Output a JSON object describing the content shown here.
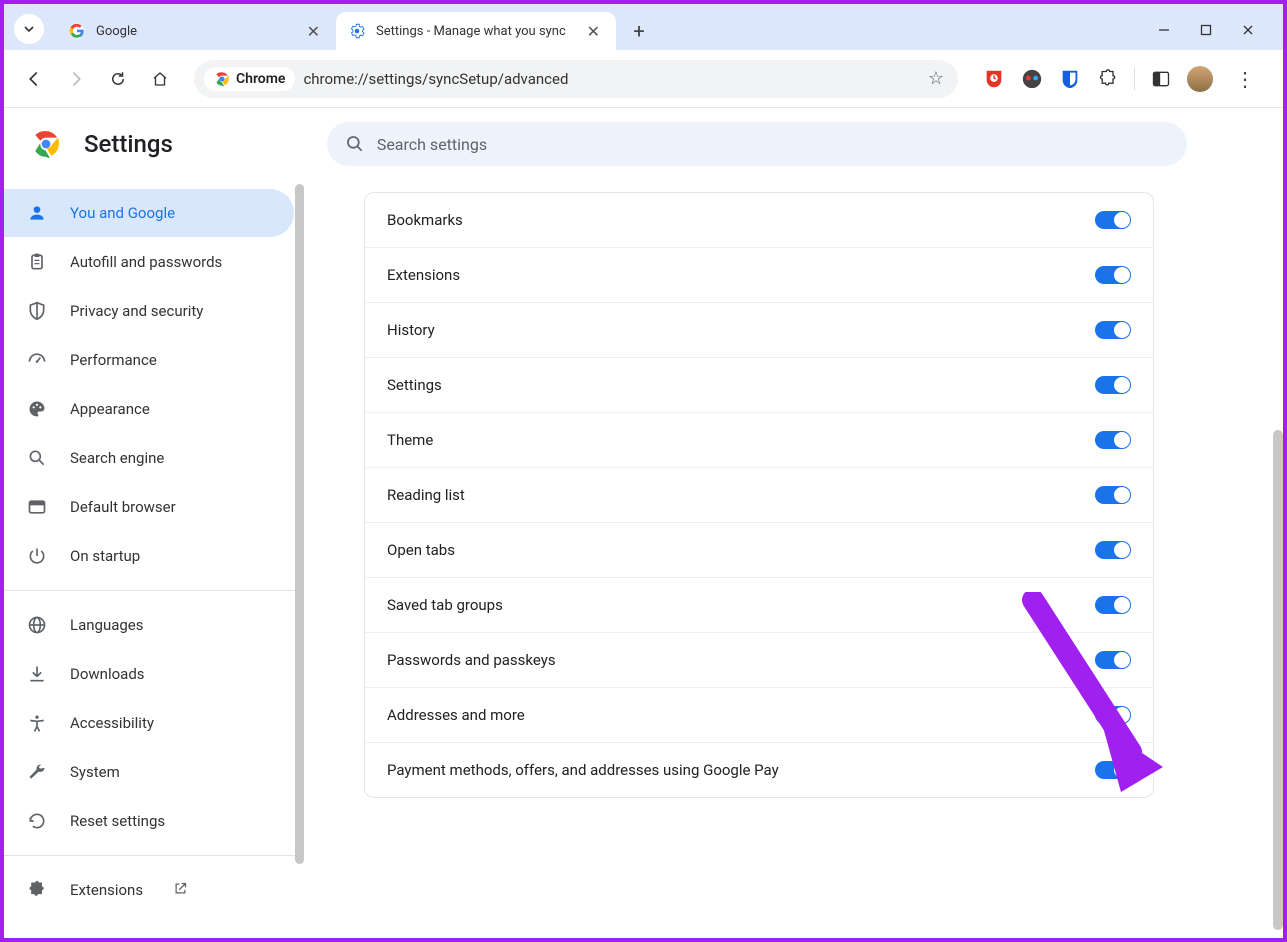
{
  "tabs": [
    {
      "title": "Google",
      "active": false
    },
    {
      "title": "Settings - Manage what you sync",
      "active": true
    }
  ],
  "url": "chrome://settings/syncSetup/advanced",
  "chrome_chip": "Chrome",
  "settings_title": "Settings",
  "search_placeholder": "Search settings",
  "sidebar": {
    "group1": [
      {
        "icon": "person",
        "label": "You and Google",
        "active": true,
        "name": "you-and-google"
      },
      {
        "icon": "clipboard",
        "label": "Autofill and passwords",
        "name": "autofill-passwords"
      },
      {
        "icon": "shield",
        "label": "Privacy and security",
        "name": "privacy-security"
      },
      {
        "icon": "speed",
        "label": "Performance",
        "name": "performance"
      },
      {
        "icon": "palette",
        "label": "Appearance",
        "name": "appearance"
      },
      {
        "icon": "search",
        "label": "Search engine",
        "name": "search-engine"
      },
      {
        "icon": "browser",
        "label": "Default browser",
        "name": "default-browser"
      },
      {
        "icon": "power",
        "label": "On startup",
        "name": "on-startup"
      }
    ],
    "group2": [
      {
        "icon": "globe",
        "label": "Languages",
        "name": "languages"
      },
      {
        "icon": "download",
        "label": "Downloads",
        "name": "downloads"
      },
      {
        "icon": "accessibility",
        "label": "Accessibility",
        "name": "accessibility"
      },
      {
        "icon": "wrench",
        "label": "System",
        "name": "system"
      },
      {
        "icon": "restore",
        "label": "Reset settings",
        "name": "reset-settings"
      }
    ],
    "group3": [
      {
        "icon": "puzzle",
        "label": "Extensions",
        "name": "extensions",
        "external": true
      }
    ]
  },
  "sync_items": [
    {
      "label": "Bookmarks",
      "on": true
    },
    {
      "label": "Extensions",
      "on": true
    },
    {
      "label": "History",
      "on": true
    },
    {
      "label": "Settings",
      "on": true
    },
    {
      "label": "Theme",
      "on": true
    },
    {
      "label": "Reading list",
      "on": true
    },
    {
      "label": "Open tabs",
      "on": true
    },
    {
      "label": "Saved tab groups",
      "on": true
    },
    {
      "label": "Passwords and passkeys",
      "on": true
    },
    {
      "label": "Addresses and more",
      "on": true
    },
    {
      "label": "Payment methods, offers, and addresses using Google Pay",
      "on": true
    }
  ],
  "arrow_color": "#a020f0"
}
